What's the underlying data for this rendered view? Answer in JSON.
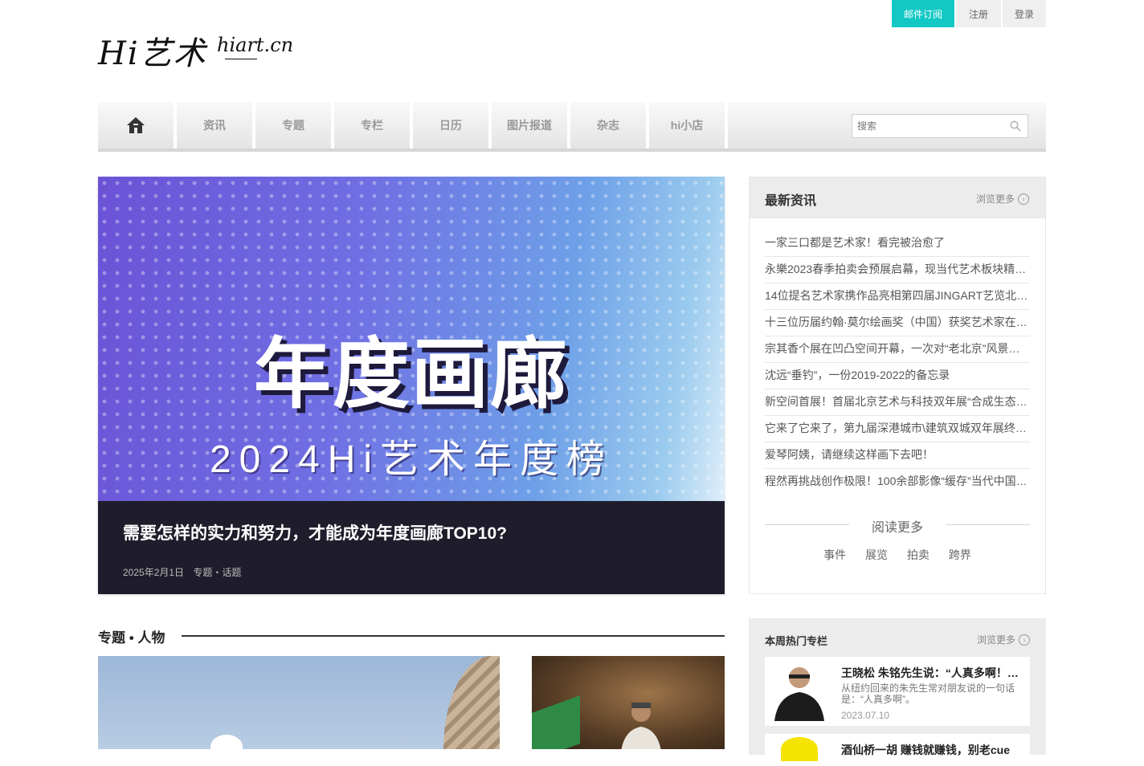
{
  "top_links": {
    "subscribe": "邮件订阅",
    "register": "注册",
    "login": "登录"
  },
  "logo": {
    "mark": "Hi艺术",
    "domain": "hiart.cn"
  },
  "nav": {
    "items": [
      "资讯",
      "专题",
      "专栏",
      "日历",
      "图片报道",
      "杂志",
      "hi小店"
    ],
    "search_placeholder": "搜索"
  },
  "hero": {
    "image_title": "年度画廊",
    "image_subtitle": "2024Hi艺术年度榜",
    "headline": "需要怎样的实力和努力，才能成为年度画廊TOP10?",
    "date": "2025年2月1日",
    "category": "专题・话题"
  },
  "latest": {
    "title": "最新资讯",
    "more": "浏览更多",
    "items": [
      "一家三口都是艺术家！看完被治愈了",
      "永樂2023春季拍卖会预展启幕，现当代艺术板块精…",
      "14位提名艺术家携作品亮相第四届JINGART艺览北…",
      "十三位历届约翰·莫尔绘画奖（中国）获奖艺术家在…",
      "宗其香个展在凹凸空间开幕，一次对“老北京”风景…",
      "沈远“垂钓”，一份2019-2022的备忘录",
      "新空间首展！首届北京艺术与科技双年展“合成生态…",
      "它来了它来了，第九届深港城市\\建筑双城双年展终…",
      "爱琴阿姨，请继续这样画下去吧！",
      "程然再挑战创作极限！100余部影像“缓存”当代中国…"
    ],
    "read_more": "阅读更多",
    "tags": [
      "事件",
      "展览",
      "拍卖",
      "跨界"
    ]
  },
  "section": {
    "title": "专题 • 人物"
  },
  "hot": {
    "title": "本周热门专栏",
    "more": "浏览更多",
    "card1": {
      "title": "王晓松 朱铭先生说：“人真多啊！…",
      "desc": "从纽约回来的朱先生常对朋友说的一句话是：“人真多啊”。",
      "date": "2023.07.10"
    },
    "card2": {
      "title": "酒仙桥一胡 赚钱就赚钱，别老cue"
    }
  }
}
